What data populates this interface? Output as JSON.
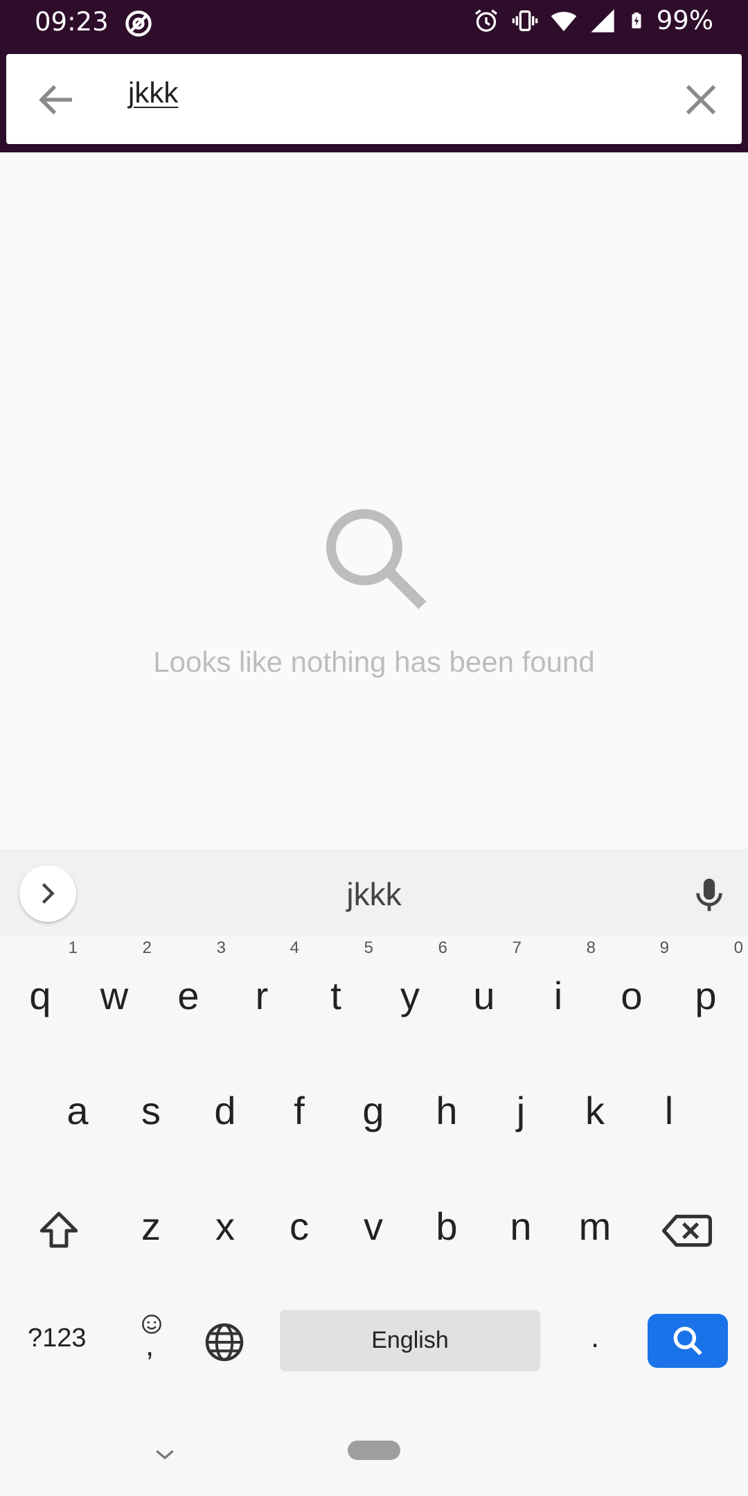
{
  "status_bar": {
    "time": "09:23",
    "battery": "99%",
    "icons": [
      "at-icon",
      "alarm-icon",
      "vibrate-icon",
      "wifi-icon",
      "signal-icon",
      "battery-charging-icon"
    ]
  },
  "search": {
    "query": "jkkk"
  },
  "empty_state": {
    "icon": "search-icon",
    "message": "Looks like nothing has been found"
  },
  "keyboard": {
    "suggestion": "jkkk",
    "row1": [
      "q",
      "w",
      "e",
      "r",
      "t",
      "y",
      "u",
      "i",
      "o",
      "p"
    ],
    "row1_hints": [
      "1",
      "2",
      "3",
      "4",
      "5",
      "6",
      "7",
      "8",
      "9",
      "0"
    ],
    "row2": [
      "a",
      "s",
      "d",
      "f",
      "g",
      "h",
      "j",
      "k",
      "l"
    ],
    "row3": [
      "z",
      "x",
      "c",
      "v",
      "b",
      "n",
      "m"
    ],
    "symbols_label": "?123",
    "comma_label": ",",
    "space_label": "English",
    "period_label": "."
  },
  "colors": {
    "status_bar_bg": "#2e0d2b",
    "accent_key": "#1a73e8",
    "empty_text": "#bdbdbd"
  }
}
